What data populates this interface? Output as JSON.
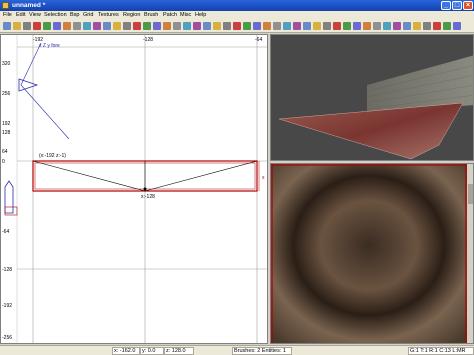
{
  "window": {
    "title": "unnamed *"
  },
  "menu": [
    "File",
    "Edit",
    "View",
    "Selection",
    "Bsp",
    "Grid",
    "Textures",
    "Region",
    "Brush",
    "Patch",
    "Misc",
    "Help"
  ],
  "grid": {
    "rulers_left": [
      "320",
      "256",
      "192",
      "128",
      "64",
      "0",
      "-64",
      "-128",
      "-192",
      "-256"
    ],
    "rulers_top": [
      "-192",
      "-128",
      "-64"
    ],
    "view_label": "x Z y fore",
    "brush_label": "(x:-192 z:-1)",
    "brush_bottom_label": "x:-128",
    "size_label": "x"
  },
  "status": {
    "x": "x: -162.0",
    "y": "y: 0.0",
    "z": "z: 128.0",
    "brushes": "Brushes: 2 Entities: 1",
    "grid_info": "G:1 T:1 R:1 C:13 L:MR"
  },
  "colors": {
    "titlebar": "#1b4ec4",
    "brush": "#b00000",
    "grid_axis": "#808080"
  }
}
